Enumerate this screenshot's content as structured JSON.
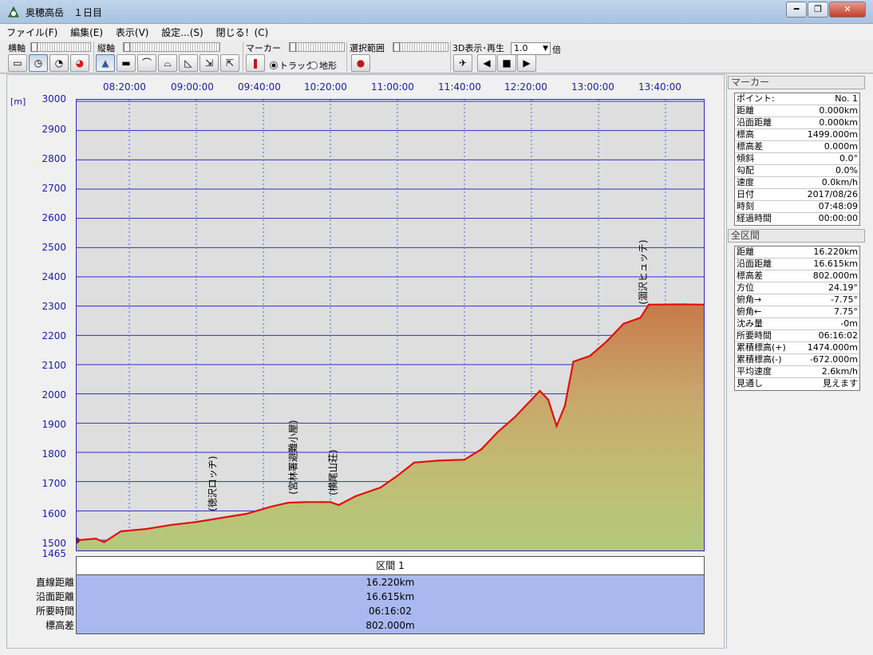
{
  "window": {
    "title": "奥穂高岳　１日目",
    "controls": {
      "minimize": "━",
      "maximize": "❐",
      "close": "✕"
    }
  },
  "menu": [
    "ファイル(F)",
    "編集(E)",
    "表示(V)",
    "設定...(S)",
    "閉じる！(C)"
  ],
  "toolbar": {
    "horizontal_axis_label": "横軸",
    "vertical_axis_label": "縦軸",
    "marker_label": "マーカー",
    "selection_label": "選択範囲",
    "playback_label": "3D表示･再生",
    "speed_value": "1.0",
    "speed_unit": "倍",
    "radio_track": "トラック",
    "radio_terrain": "地形"
  },
  "time_axis": [
    "08:20:00",
    "09:00:00",
    "09:40:00",
    "10:20:00",
    "11:00:00",
    "11:40:00",
    "12:20:00",
    "13:00:00",
    "13:40:00"
  ],
  "elevation_unit": "[m]",
  "elevation_labels": [
    "3000",
    "2900",
    "2800",
    "2700",
    "2600",
    "2500",
    "2400",
    "2300",
    "2200",
    "2100",
    "2000",
    "1900",
    "1800",
    "1700",
    "1600",
    "1500",
    "1465"
  ],
  "chart_data": {
    "type": "area",
    "x_axis_ticks": [
      "08:20:00",
      "09:00:00",
      "09:40:00",
      "10:20:00",
      "11:00:00",
      "11:40:00",
      "12:20:00",
      "13:00:00",
      "13:40:00"
    ],
    "ylabel": "[m]",
    "ylim": [
      1465,
      3000
    ],
    "grid": true,
    "series": [
      {
        "color": "#e01010",
        "x": [
          "07:48",
          "08:00",
          "08:05",
          "08:15",
          "08:30",
          "08:45",
          "09:00",
          "09:15",
          "09:30",
          "09:45",
          "09:55",
          "10:05",
          "10:15",
          "10:20",
          "10:25",
          "10:35",
          "10:50",
          "11:00",
          "11:10",
          "11:25",
          "11:40",
          "11:50",
          "12:00",
          "12:10",
          "12:20",
          "12:25",
          "12:30",
          "12:35",
          "12:40",
          "12:45",
          "12:55",
          "13:05",
          "13:15",
          "13:25",
          "13:30",
          "13:50",
          "14:04"
        ],
        "values": [
          1499,
          1505,
          1493,
          1530,
          1538,
          1552,
          1562,
          1576,
          1590,
          1615,
          1628,
          1630,
          1630,
          1630,
          1620,
          1650,
          1680,
          1720,
          1765,
          1772,
          1775,
          1810,
          1870,
          1920,
          1980,
          2010,
          1980,
          1890,
          1960,
          2110,
          2130,
          2180,
          2240,
          2260,
          2305,
          2306,
          2305
        ]
      }
    ],
    "annotations": [
      {
        "label": "徳沢ロッヂ",
        "x": "09:10"
      },
      {
        "label": "宮林署避難小屋",
        "x": "09:58"
      },
      {
        "label": "横尾山荘",
        "x": "10:22"
      },
      {
        "label": "涸沢ヒュッテ",
        "x": "13:27"
      }
    ]
  },
  "interval": {
    "header": "区間 1",
    "rows": [
      {
        "label": "直線距離",
        "value": "16.220km"
      },
      {
        "label": "沿面距離",
        "value": "16.615km"
      },
      {
        "label": "所要時間",
        "value": "06:16:02"
      },
      {
        "label": "標高差",
        "value": "802.000m"
      }
    ]
  },
  "marker_panel": {
    "title": "マーカー",
    "rows": [
      {
        "key": "ポイント:",
        "value": "No. 1"
      },
      {
        "key": "距離",
        "value": "0.000km"
      },
      {
        "key": "沿面距離",
        "value": "0.000km"
      },
      {
        "key": "標高",
        "value": "1499.000m"
      },
      {
        "key": "標高差",
        "value": "0.000m"
      },
      {
        "key": "傾斜",
        "value": "0.0°"
      },
      {
        "key": "勾配",
        "value": "0.0%"
      },
      {
        "key": "速度",
        "value": "0.0km/h"
      },
      {
        "key": "日付",
        "value": "2017/08/26"
      },
      {
        "key": "時刻",
        "value": "07:48:09"
      },
      {
        "key": "経過時間",
        "value": "00:00:00"
      }
    ]
  },
  "total_panel": {
    "title": "全区間",
    "rows": [
      {
        "key": "距離",
        "value": "16.220km"
      },
      {
        "key": "沿面距離",
        "value": "16.615km"
      },
      {
        "key": "標高差",
        "value": "802.000m"
      },
      {
        "key": "方位",
        "value": "24.19°"
      },
      {
        "key": "俯角→",
        "value": "-7.75°"
      },
      {
        "key": "俯角←",
        "value": "7.75°"
      },
      {
        "key": "沈み量",
        "value": "-0m"
      },
      {
        "key": "所要時間",
        "value": "06:16:02"
      },
      {
        "key": "累積標高(+)",
        "value": "1474.000m"
      },
      {
        "key": "累積標高(-)",
        "value": "-672.000m"
      },
      {
        "key": "平均速度",
        "value": "2.6km/h"
      },
      {
        "key": "見通し",
        "value": "見えます"
      }
    ]
  }
}
